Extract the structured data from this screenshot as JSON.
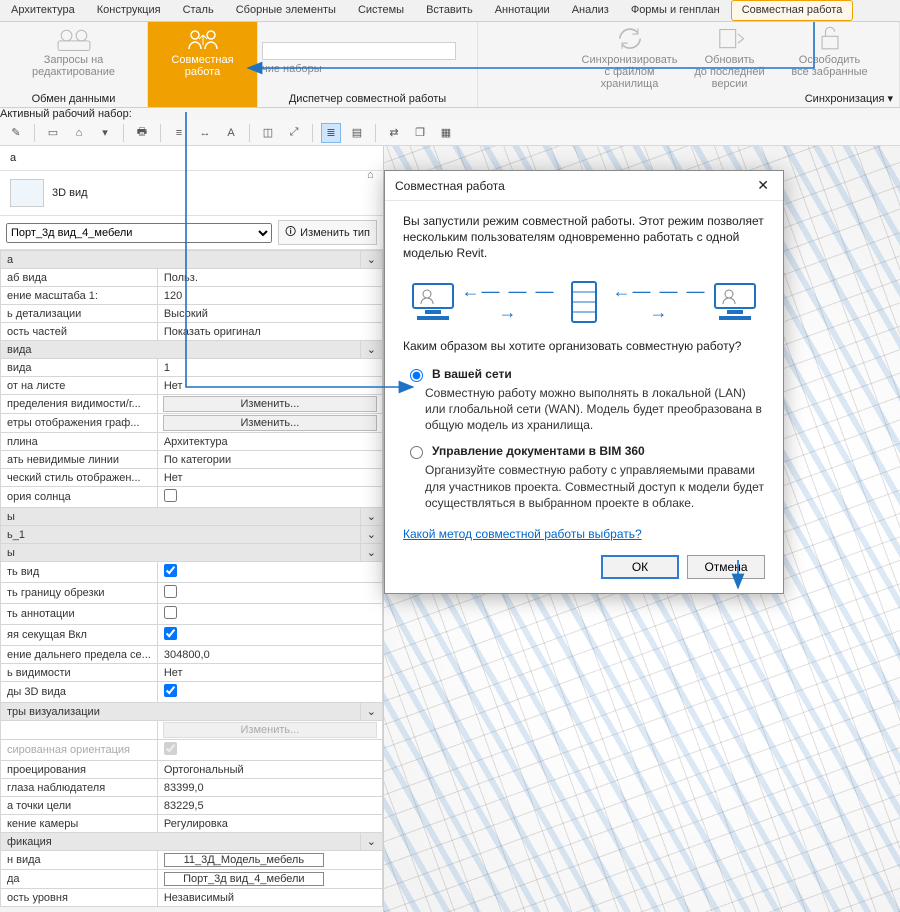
{
  "tabs": [
    "Архитектура",
    "Конструкция",
    "Сталь",
    "Сборные элементы",
    "Системы",
    "Вставить",
    "Аннотации",
    "Анализ",
    "Формы и генплан",
    "Совместная работа"
  ],
  "active_tab_index": 9,
  "ribbon": {
    "overlabel": "Активный рабочий набор:",
    "worksets_btn": "чие наборы",
    "panel1": {
      "btn1": "",
      "btn2": "Запросы на\nредактирование",
      "footer": "Обмен данными"
    },
    "panel2": {
      "btn": "Совместная\nработа"
    },
    "panel3_footer": "Диспетчер совместной работы",
    "panel_sync": {
      "btn1": "Синхронизировать\nс файлом хранилища",
      "btn2": "Обновить\nдо последней версии",
      "btn3": "Освободить\nвсе забранные",
      "footer": "Синхронизация  ▾"
    }
  },
  "props": {
    "panel_name": "а",
    "type_label": "3D вид",
    "view_select": "Порт_3д вид_4_мебели",
    "edit_type": "Изменить тип",
    "sections": {
      "s1": "а",
      "s2": "вида",
      "s3": "ы",
      "s4": "ь_1",
      "s5": "ы",
      "s6": "тры визуализации",
      "s7": "фикация"
    },
    "rows": {
      "r1": {
        "k": "аб вида",
        "v": "Польз."
      },
      "r2": {
        "k": "ение масштаба    1:",
        "v": "120"
      },
      "r3": {
        "k": "ь детализации",
        "v": "Высокий"
      },
      "r4": {
        "k": "ость частей",
        "v": "Показать оригинал"
      },
      "r5": {
        "k": "вида",
        "v": "1"
      },
      "r6": {
        "k": "от на листе",
        "v": "Нет"
      },
      "r7": {
        "k": "пределения видимости/г...",
        "btn": "Изменить..."
      },
      "r8": {
        "k": "етры отображения граф...",
        "btn": "Изменить..."
      },
      "r9": {
        "k": "плина",
        "v": "Архитектура"
      },
      "r10": {
        "k": "ать невидимые линии",
        "v": "По категории"
      },
      "r11": {
        "k": "ческий стиль отображен...",
        "v": "Нет"
      },
      "r12": {
        "k": "ория солнца",
        "v": ""
      },
      "r13": {
        "k": "ть вид",
        "chk": true
      },
      "r14": {
        "k": "ть границу обрезки",
        "chk": false
      },
      "r15": {
        "k": "ть аннотации",
        "chk": false
      },
      "r16": {
        "k": "яя секущая Вкл",
        "chk": true
      },
      "r17": {
        "k": "ение дальнего предела се...",
        "v": "304800,0"
      },
      "r18": {
        "k": "ь видимости",
        "v": "Нет"
      },
      "r19": {
        "k": "ды 3D вида",
        "chk": true
      },
      "r20": {
        "k": "",
        "btn": "Изменить...",
        "dim": true
      },
      "r21": {
        "k": "сированная ориентация",
        "chk": true,
        "dim": true
      },
      "r22": {
        "k": "проецирования",
        "v": "Ортогональный"
      },
      "r23": {
        "k": "глаза наблюдателя",
        "v": "83399,0"
      },
      "r24": {
        "k": "а точки цели",
        "v": "83229,5"
      },
      "r25": {
        "k": "кение камеры",
        "v": "Регулировка"
      },
      "r26": {
        "k": "н вида",
        "box": "11_3Д_Модель_мебель"
      },
      "r27": {
        "k": "да",
        "box": "Порт_3д вид_4_мебели"
      },
      "r28": {
        "k": "ость уровня",
        "v": "Независимый"
      }
    }
  },
  "dialog": {
    "title": "Совместная работа",
    "intro": "Вы запустили режим совместной работы. Этот режим позволяет нескольким пользователям одновременно работать с одной моделью Revit.",
    "question": "Каким образом вы хотите организовать совместную работу?",
    "opt1_label": "В вашей сети",
    "opt1_desc": "Совместную работу можно выполнять в локальной (LAN) или глобальной сети (WAN). Модель будет преобразована в общую модель из хранилища.",
    "opt2_label": "Управление документами в BIM 360",
    "opt2_desc": "Организуйте совместную работу с управляемыми правами для участников проекта. Совместный доступ к модели будет осуществляться в выбранном проекте в облаке.",
    "link": "Какой метод совместной работы выбрать?",
    "ok": "ОК",
    "cancel": "Отмена"
  }
}
